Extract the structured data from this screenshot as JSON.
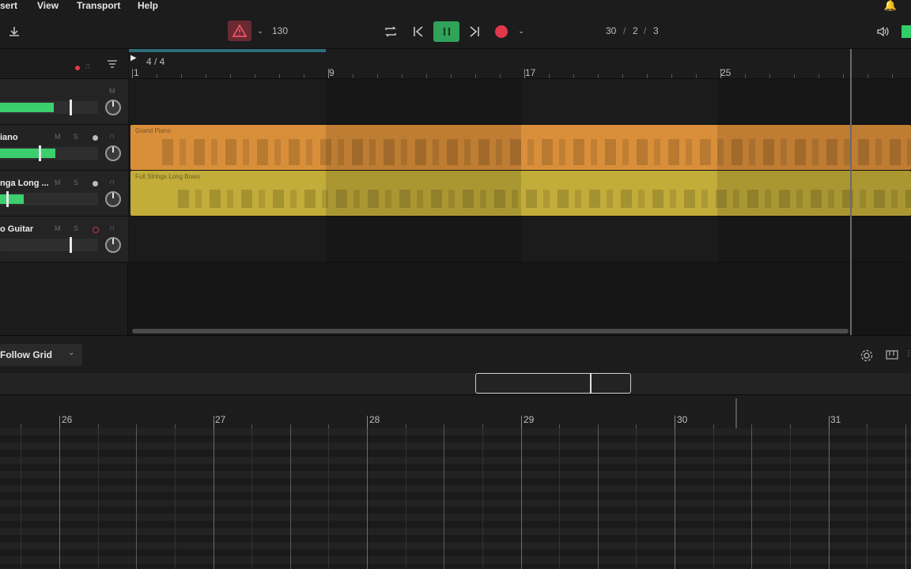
{
  "menu": [
    "sert",
    "View",
    "Transport",
    "Help"
  ],
  "toolbar": {
    "tempo": "130",
    "position": "30",
    "position_sep1": "/",
    "position_beat": "2",
    "position_sep2": "/",
    "position_div": "3",
    "warning_color": "#e0455a",
    "play_color": "#2fa35a",
    "record_color": "#e5374a"
  },
  "ruler": {
    "time_signature": "4 / 4",
    "bars": [
      "1",
      "9",
      "17",
      "25"
    ]
  },
  "tracks": [
    {
      "name": "",
      "m": "M",
      "s": "",
      "meter_level": 0.55
    },
    {
      "name": "iano",
      "m": "M",
      "s": "S",
      "meter_level": 0.5
    },
    {
      "name": "nga Long ...",
      "m": "M",
      "s": "S",
      "meter_level": 0.2
    },
    {
      "name": "o Guitar",
      "m": "M",
      "s": "S",
      "meter_level": 0.0
    }
  ],
  "regions": [
    {
      "label": "Grand Piano",
      "color": "#d98f3a"
    },
    {
      "label": "Full Strings Long Bows",
      "color": "#c2ac3a"
    }
  ],
  "editor": {
    "grid_mode": "Follow Grid",
    "bars": [
      "26",
      "27",
      "28",
      "29",
      "30",
      "31"
    ]
  }
}
